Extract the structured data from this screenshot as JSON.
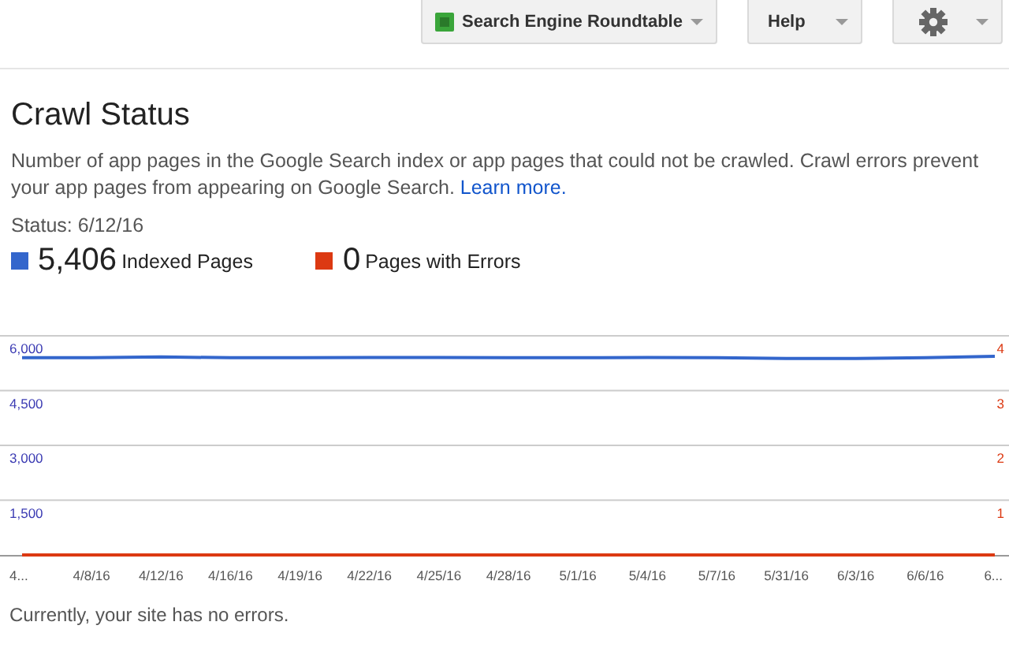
{
  "header": {
    "site_button": {
      "label": "Search Engine Roundtable"
    },
    "help_button": {
      "label": "Help"
    }
  },
  "title": "Crawl Status",
  "description": "Number of app pages in the Google Search index or app pages that could not be crawled. Crawl errors prevent your app pages from appearing on Google Search.",
  "description_link": "Learn more.",
  "status": "Status: 6/12/16",
  "legend": [
    {
      "count": "5,406"
    },
    {
      "count": "0"
    }
  ],
  "chart": {
    "chart_data": {
      "type": "line",
      "categories": [
        "4...",
        "4/8/16",
        "4/12/16",
        "4/16/16",
        "4/19/16",
        "4/22/16",
        "4/25/16",
        "4/28/16",
        "5/1/16",
        "5/4/16",
        "5/7/16",
        "5/31/16",
        "6/3/16",
        "6/6/16",
        "6..."
      ],
      "series": [
        {
          "name": "Indexed Pages",
          "color": "#3366cc",
          "values": [
            5400,
            5400,
            5420,
            5400,
            5400,
            5410,
            5410,
            5400,
            5400,
            5410,
            5400,
            5380,
            5380,
            5400,
            5440
          ]
        },
        {
          "name": "Pages with Errors",
          "color": "#dc3912",
          "values": [
            0,
            0,
            0,
            0,
            0,
            0,
            0,
            0,
            0,
            0,
            0,
            0,
            0,
            0,
            0
          ]
        }
      ],
      "ylim": [
        0,
        6000
      ],
      "yticks": [
        {
          "value": 1500,
          "label": "1,500"
        },
        {
          "value": 3000,
          "label": "3,000"
        },
        {
          "value": 4500,
          "label": "4,500"
        },
        {
          "value": 6000,
          "label": "6,000"
        }
      ],
      "y2lim": [
        0,
        4
      ],
      "y2ticks": [
        1,
        2,
        3,
        4
      ],
      "grid": true
    }
  },
  "footer_note": "Currently, your site has no errors."
}
